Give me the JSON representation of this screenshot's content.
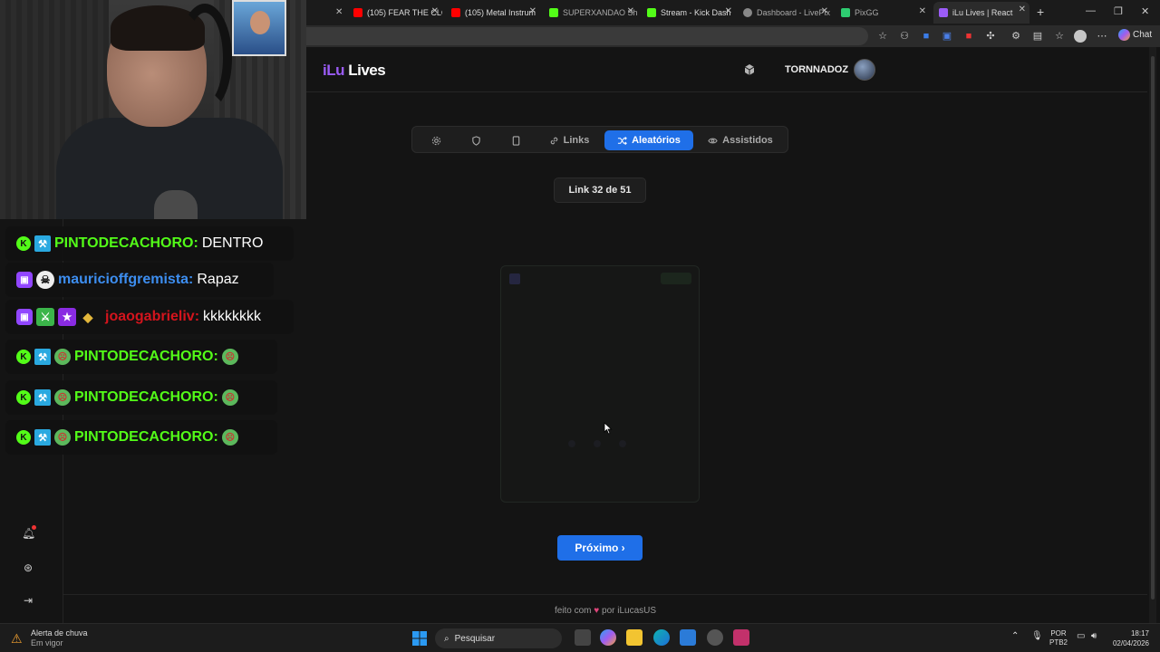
{
  "browser": {
    "tabs": [
      {
        "label": "(105) FEAR THE CLC",
        "color": "#ff0000"
      },
      {
        "label": "(105) Metal Instrum",
        "color": "#ff0000"
      },
      {
        "label": "SUPERXANDAO Sh",
        "color": "#53fc18"
      },
      {
        "label": "Stream - Kick Dash",
        "color": "#53fc18"
      },
      {
        "label": "Dashboard - LivePix",
        "color": "#888888"
      },
      {
        "label": "PixGG",
        "color": "#2ecc71"
      },
      {
        "label": "iLu Lives | React",
        "color": "#9b5cf6"
      }
    ],
    "chat_button": "Chat"
  },
  "app": {
    "logo_a": "iLu",
    "logo_b": "Lives",
    "username": "TORNNADOZ",
    "tabs": [
      {
        "label": "",
        "icon": "gear-icon"
      },
      {
        "label": "",
        "icon": "shield-icon"
      },
      {
        "label": "",
        "icon": "tablet-icon"
      },
      {
        "label": "Links",
        "icon": "link-icon"
      },
      {
        "label": "Aleatórios",
        "icon": "shuffle-icon",
        "selected": true
      },
      {
        "label": "Assistidos",
        "icon": "eye-icon"
      }
    ],
    "counter": "Link 32 de 51",
    "next_button": "Próximo ›",
    "footer_a": "feito com",
    "footer_heart": "♥",
    "footer_b": "por iLucasUS",
    "accent": "#1f6fe8"
  },
  "chat": [
    {
      "user": "PINTODECACHORO:",
      "message": "DENTRO",
      "color": "#53fc18"
    },
    {
      "user": "mauricioffgremista:",
      "message": "Rapaz",
      "color": "#3d8ef0"
    },
    {
      "user": "joaogabrieliv:",
      "message": "kkkkkkkk",
      "color": "#d4141d"
    },
    {
      "user": "PINTODECACHORO:",
      "message": "",
      "color": "#53fc18"
    },
    {
      "user": "PINTODECACHORO:",
      "message": "",
      "color": "#53fc18"
    },
    {
      "user": "PINTODECACHORO:",
      "message": "",
      "color": "#53fc18"
    }
  ],
  "taskbar": {
    "weather_title": "Alerta de chuva",
    "weather_sub": "Em vigor",
    "search": "Pesquisar",
    "lang_a": "POR",
    "lang_b": "PTB2",
    "time": "18:17",
    "date": "02/04/2026"
  }
}
